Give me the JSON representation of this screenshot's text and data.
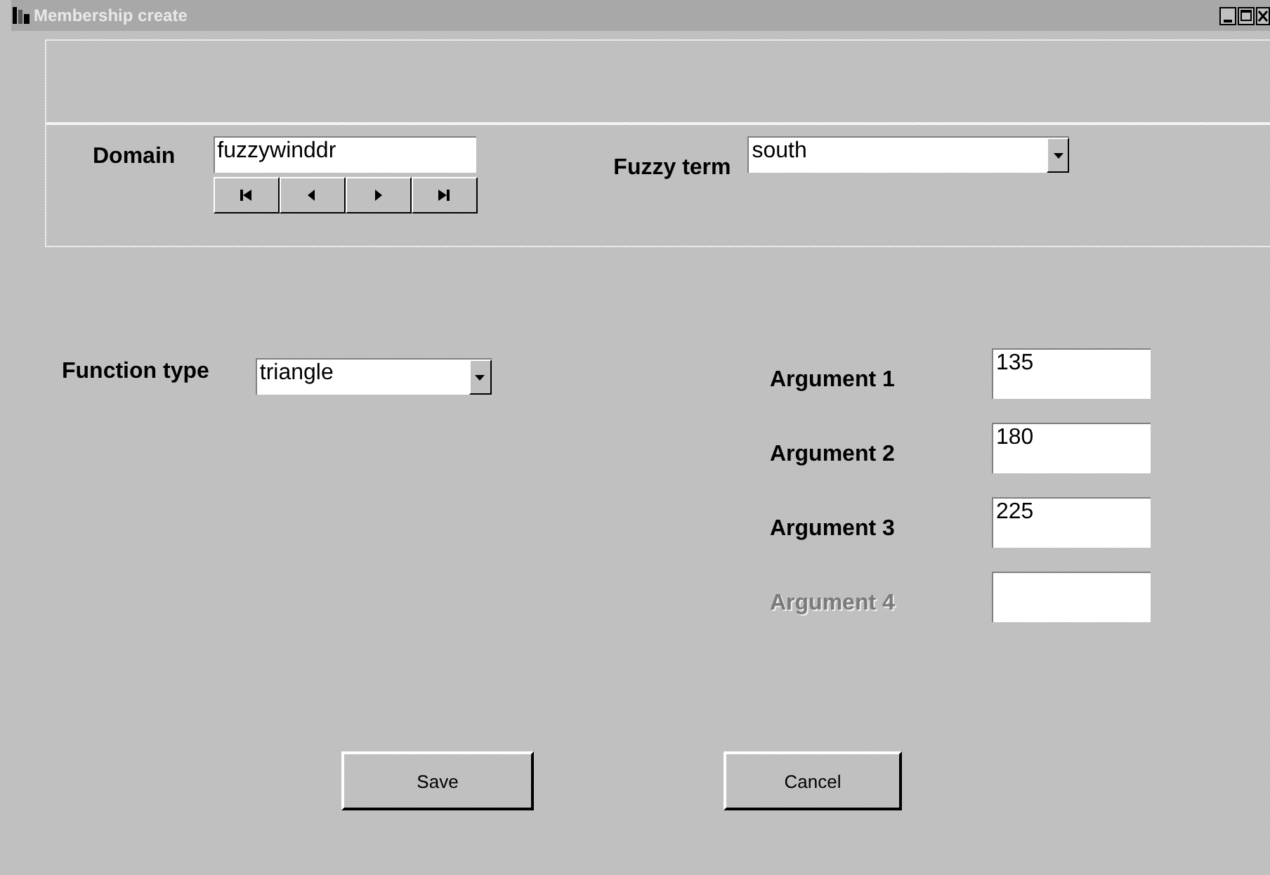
{
  "window": {
    "title": "Membership create"
  },
  "domain": {
    "label": "Domain",
    "value": "fuzzywinddr"
  },
  "fuzzy_term": {
    "label": "Fuzzy term",
    "value": "south"
  },
  "function_type": {
    "label": "Function type",
    "value": "triangle"
  },
  "arguments": [
    {
      "label": "Argument 1",
      "value": "135",
      "disabled": false
    },
    {
      "label": "Argument 2",
      "value": "180",
      "disabled": false
    },
    {
      "label": "Argument 3",
      "value": "225",
      "disabled": false
    },
    {
      "label": "Argument 4",
      "disabled": true
    }
  ],
  "buttons": [
    "Save",
    "Cancel"
  ]
}
